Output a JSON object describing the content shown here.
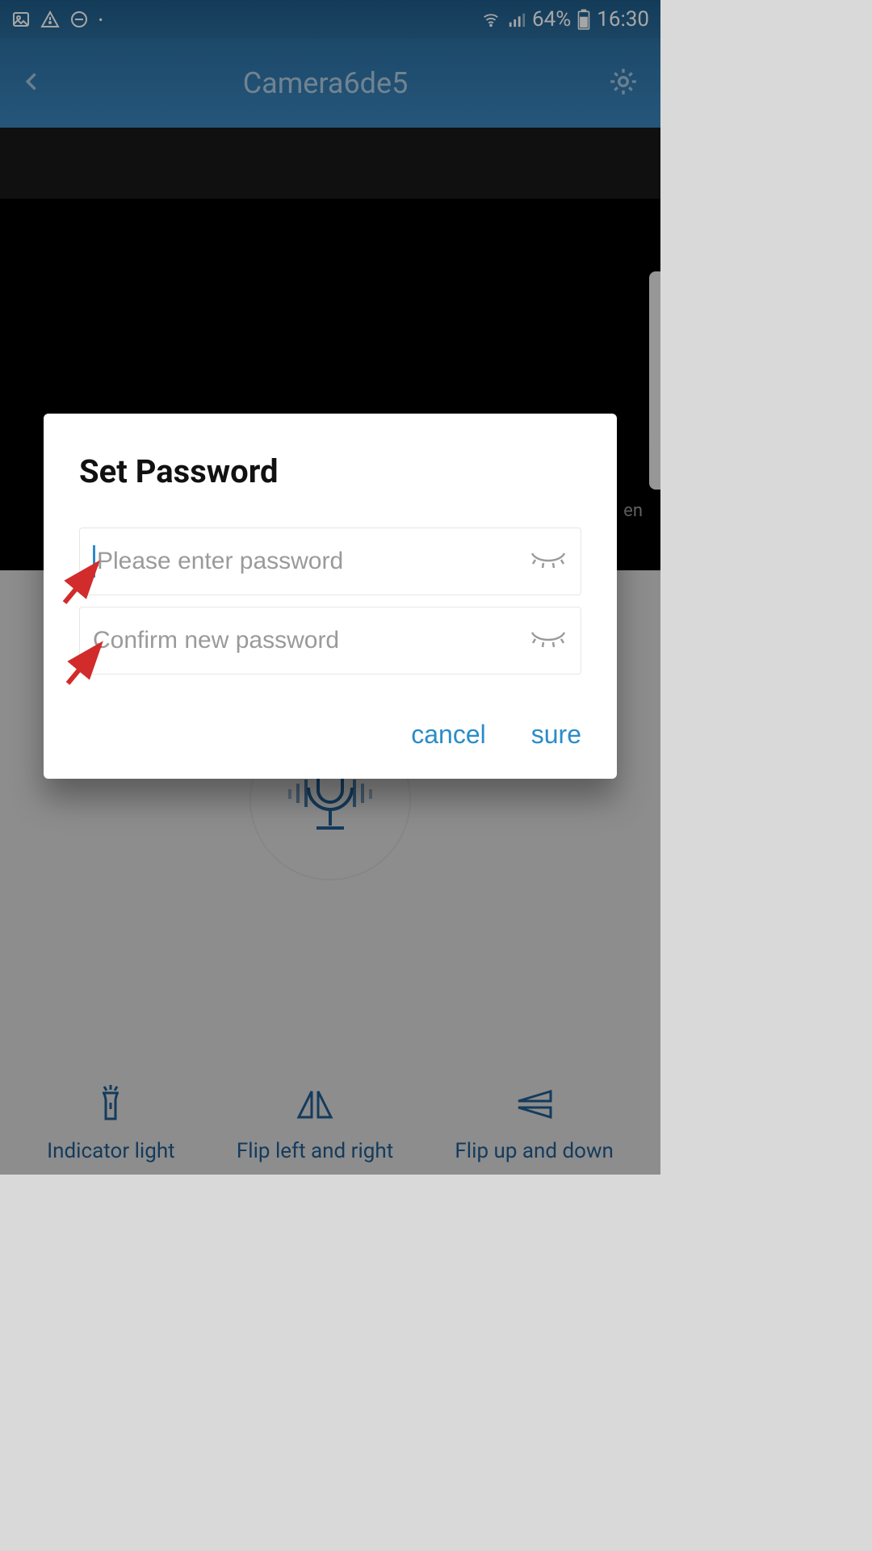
{
  "status": {
    "battery": "64%",
    "time": "16:30"
  },
  "header": {
    "title": "Camera6de5"
  },
  "video": {
    "side_label": "en"
  },
  "dialog": {
    "title": "Set Password",
    "password_placeholder": "Please enter password",
    "confirm_placeholder": "Confirm new password",
    "cancel_label": "cancel",
    "sure_label": "sure"
  },
  "controls": {
    "indicator": "Indicator light",
    "flip_lr": "Flip left and right",
    "flip_ud": "Flip up and down"
  }
}
